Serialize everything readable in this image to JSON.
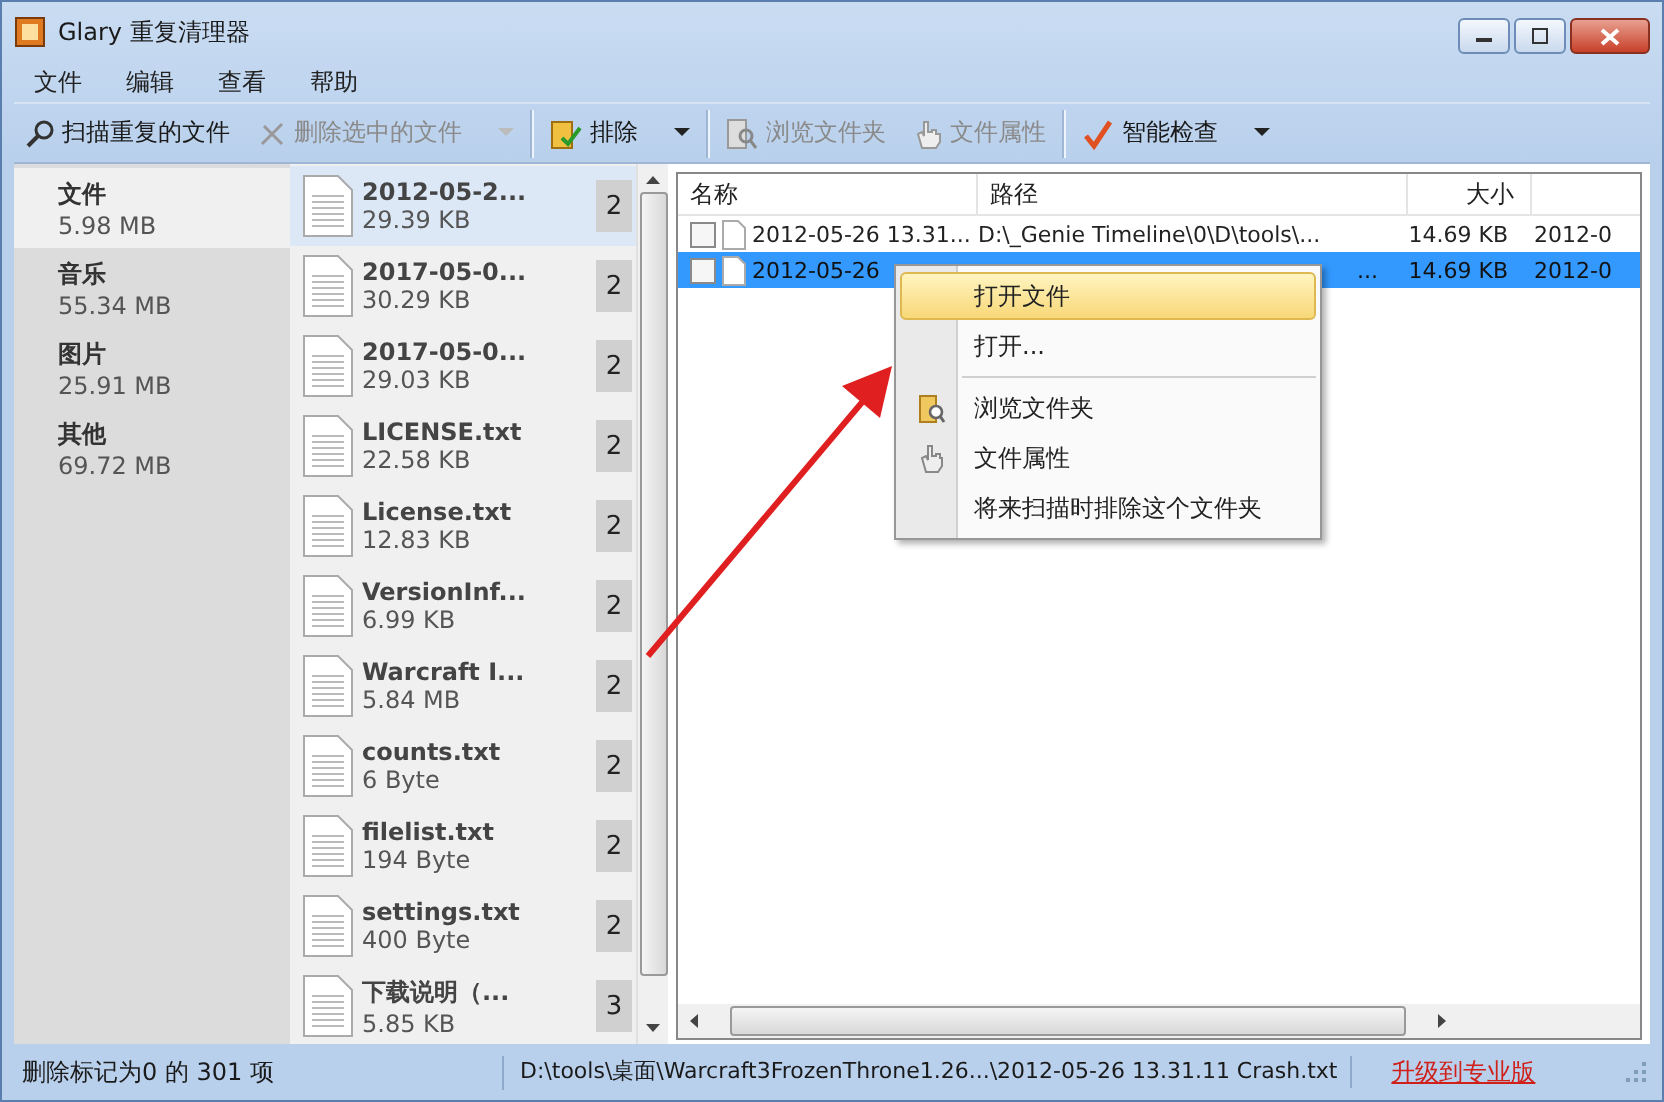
{
  "window": {
    "title": "Glary 重复清理器"
  },
  "menu": [
    "文件",
    "编辑",
    "查看",
    "帮助"
  ],
  "toolbar": [
    {
      "label": "扫描重复的文件",
      "disabled": false,
      "dropdown": false
    },
    {
      "label": "删除选中的文件",
      "disabled": true,
      "dropdown": true
    },
    {
      "label": "排除",
      "disabled": false,
      "dropdown": true
    },
    {
      "label": "浏览文件夹",
      "disabled": true,
      "dropdown": false
    },
    {
      "label": "文件属性",
      "disabled": true,
      "dropdown": false
    },
    {
      "label": "智能检查",
      "disabled": false,
      "dropdown": true
    }
  ],
  "categories": [
    {
      "name": "文件",
      "size": "5.98 MB",
      "selected": true
    },
    {
      "name": "音乐",
      "size": "55.34 MB",
      "selected": false
    },
    {
      "name": "图片",
      "size": "25.91 MB",
      "selected": false
    },
    {
      "name": "其他",
      "size": "69.72 MB",
      "selected": false
    }
  ],
  "groups": [
    {
      "name": "2012-05-2...",
      "size": "29.39 KB",
      "count": "2",
      "selected": true
    },
    {
      "name": "2017-05-0...",
      "size": "30.29 KB",
      "count": "2",
      "selected": false
    },
    {
      "name": "2017-05-0...",
      "size": "29.03 KB",
      "count": "2",
      "selected": false
    },
    {
      "name": "LICENSE.txt",
      "size": "22.58 KB",
      "count": "2",
      "selected": false
    },
    {
      "name": "License.txt",
      "size": "12.83 KB",
      "count": "2",
      "selected": false
    },
    {
      "name": "VersionInf...",
      "size": "6.99 KB",
      "count": "2",
      "selected": false
    },
    {
      "name": "Warcraft I...",
      "size": "5.84 MB",
      "count": "2",
      "selected": false
    },
    {
      "name": "counts.txt",
      "size": "6 Byte",
      "count": "2",
      "selected": false
    },
    {
      "name": "filelist.txt",
      "size": "194 Byte",
      "count": "2",
      "selected": false
    },
    {
      "name": "settings.txt",
      "size": "400 Byte",
      "count": "2",
      "selected": false
    },
    {
      "name": "下载说明（...",
      "size": "5.85 KB",
      "count": "3",
      "selected": false
    }
  ],
  "table": {
    "columns": [
      "名称",
      "路径",
      "大小"
    ],
    "rows": [
      {
        "checked": false,
        "selected": false,
        "name": "2012-05-26 13.31...",
        "path": "D:\\_Genie Timeline\\0\\D\\tools\\...",
        "size": "14.69 KB",
        "column_4": "2012-0"
      },
      {
        "checked": false,
        "selected": true,
        "name": "2012-05-26",
        "path": "...",
        "size": "14.69 KB",
        "column_4": "2012-0"
      }
    ]
  },
  "context_menu": [
    {
      "kind": "item",
      "label": "打开文件",
      "selected": true
    },
    {
      "kind": "item",
      "label": "打开...",
      "selected": false
    },
    {
      "kind": "separator"
    },
    {
      "kind": "item",
      "label": "浏览文件夹",
      "selected": false
    },
    {
      "kind": "item",
      "label": "文件属性",
      "selected": false
    },
    {
      "kind": "item",
      "label": "将来扫描时排除这个文件夹",
      "selected": false
    }
  ],
  "status_bar": {
    "summary": "删除标记为0 的 301 项",
    "path": "D:\\tools\\桌面\\Warcraft3FrozenThrone1.26...\\2012-05-26 13.31.11 Crash.txt",
    "link": "升级到专业版"
  }
}
